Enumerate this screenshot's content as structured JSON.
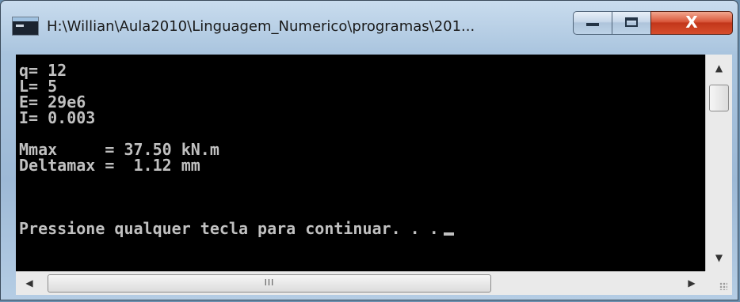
{
  "window": {
    "title": "H:\\Willian\\Aula2010\\Linguagem_Numerico\\programas\\201...",
    "icon": "console-icon",
    "close_glyph": "X"
  },
  "console": {
    "lines": [
      "q= 12",
      "L= 5",
      "E= 29e6",
      "I= 0.003",
      "",
      "Mmax     = 37.50 kN.m",
      "Deltamax =  1.12 mm",
      "",
      "",
      "Pressione qualquer tecla para continuar. . ."
    ],
    "text_color": "#c0c0c0",
    "background": "#000000"
  },
  "scrollbars": {
    "up_arrow": "▲",
    "down_arrow": "▼",
    "left_arrow": "◀",
    "right_arrow": "▶",
    "h_thumb_grip": "III"
  }
}
